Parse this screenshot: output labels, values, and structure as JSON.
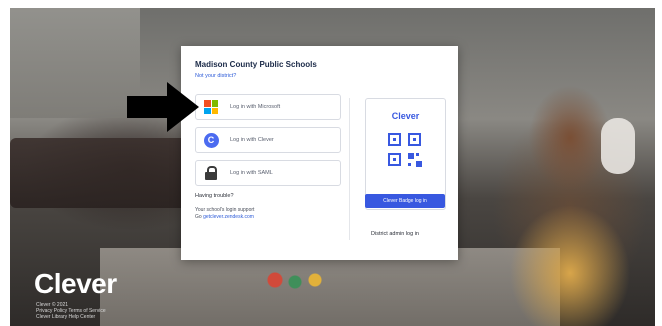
{
  "card": {
    "district_name": "Madison County Public Schools",
    "not_district": "Not your district?",
    "login_options": [
      {
        "label": "Log in with Microsoft",
        "icon": "microsoft-icon"
      },
      {
        "label": "Log in with Clever",
        "icon": "clever-c-icon"
      },
      {
        "label": "Log in with SAML",
        "icon": "lock-icon"
      }
    ],
    "help_title": "Having trouble?",
    "help_text_line1": "Your school's login support",
    "help_text_prefix": "Go",
    "help_link": "getclever.zendesk.com",
    "qr": {
      "brand": "Clever",
      "button_label": "Clever Badge log in",
      "icon": "qr-code-icon"
    },
    "district_admin_label": "District admin log in"
  },
  "footer": {
    "logo": "Clever",
    "lines": [
      "Clever © 2021",
      "Privacy Policy  Terms of Service",
      "Clever Library  Help Center"
    ]
  },
  "colors": {
    "accent": "#3858e0",
    "link": "#2d5bd8"
  }
}
